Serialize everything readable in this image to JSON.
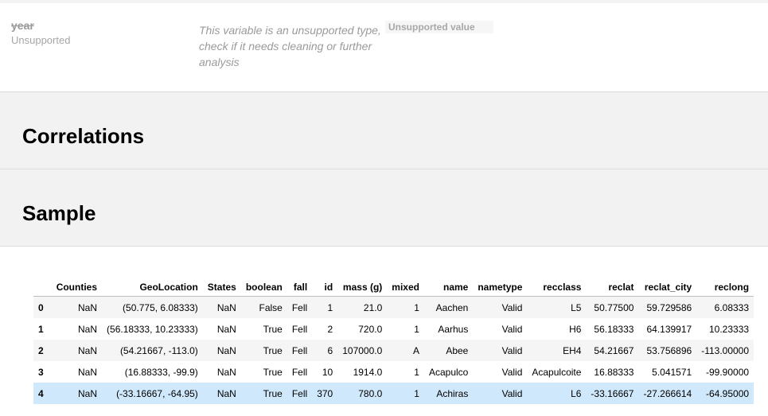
{
  "variable": {
    "name": "year",
    "type": "Unsupported",
    "message": "This variable is an unsupported type, check if it needs cleaning or further analysis",
    "badge": "Unsupported value"
  },
  "sections": {
    "correlations": "Correlations",
    "sample": "Sample"
  },
  "sample_table": {
    "columns": [
      "",
      "Counties",
      "GeoLocation",
      "States",
      "boolean",
      "fall",
      "id",
      "mass (g)",
      "mixed",
      "name",
      "nametype",
      "recclass",
      "reclat",
      "reclat_city",
      "reclong"
    ],
    "rows": [
      [
        "0",
        "NaN",
        "(50.775, 6.08333)",
        "NaN",
        "False",
        "Fell",
        "1",
        "21.0",
        "1",
        "Aachen",
        "Valid",
        "L5",
        "50.77500",
        "59.729586",
        "6.08333"
      ],
      [
        "1",
        "NaN",
        "(56.18333, 10.23333)",
        "NaN",
        "True",
        "Fell",
        "2",
        "720.0",
        "1",
        "Aarhus",
        "Valid",
        "H6",
        "56.18333",
        "64.139917",
        "10.23333"
      ],
      [
        "2",
        "NaN",
        "(54.21667, -113.0)",
        "NaN",
        "True",
        "Fell",
        "6",
        "107000.0",
        "A",
        "Abee",
        "Valid",
        "EH4",
        "54.21667",
        "53.756896",
        "-113.00000"
      ],
      [
        "3",
        "NaN",
        "(16.88333, -99.9)",
        "NaN",
        "True",
        "Fell",
        "10",
        "1914.0",
        "1",
        "Acapulco",
        "Valid",
        "Acapulcoite",
        "16.88333",
        "5.041571",
        "-99.90000"
      ],
      [
        "4",
        "NaN",
        "(-33.16667, -64.95)",
        "NaN",
        "True",
        "Fell",
        "370",
        "780.0",
        "1",
        "Achiras",
        "Valid",
        "L6",
        "-33.16667",
        "-27.266614",
        "-64.95000"
      ]
    ],
    "highlighted_row": 4
  }
}
